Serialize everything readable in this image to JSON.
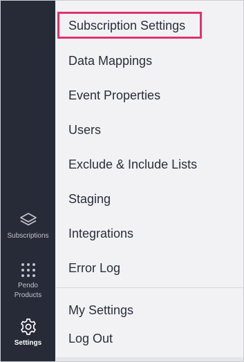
{
  "sidebar": {
    "items": [
      {
        "label": "Subscriptions",
        "icon": "layers-icon",
        "active": false
      },
      {
        "label": "Pendo Products",
        "icon": "grid-dots-icon",
        "active": false
      },
      {
        "label": "Settings",
        "icon": "gear-icon",
        "active": true
      }
    ]
  },
  "menu": {
    "items": [
      {
        "label": "Subscription Settings",
        "highlighted": true
      },
      {
        "label": "Data Mappings"
      },
      {
        "label": "Event Properties"
      },
      {
        "label": "Users"
      },
      {
        "label": "Exclude & Include Lists"
      },
      {
        "label": "Staging"
      },
      {
        "label": "Integrations"
      },
      {
        "label": "Error Log"
      }
    ],
    "account_items": [
      {
        "label": "My Settings"
      },
      {
        "label": "Log Out"
      }
    ]
  },
  "colors": {
    "sidebar_bg": "#272b37",
    "menu_bg": "#f2f2f4",
    "highlight_border": "#e0326b",
    "text": "#2a2e3a"
  }
}
